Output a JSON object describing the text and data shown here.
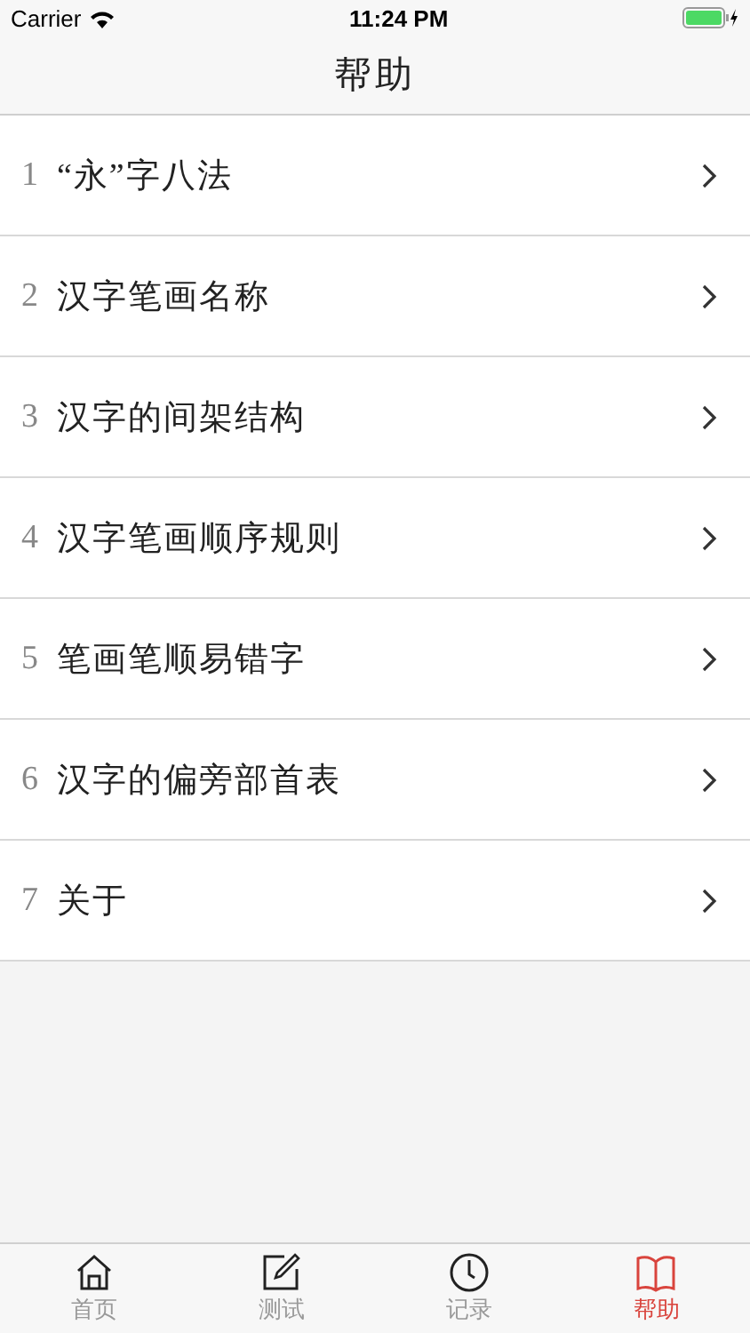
{
  "status_bar": {
    "carrier": "Carrier",
    "time": "11:24 PM"
  },
  "nav": {
    "title": "帮助"
  },
  "items": [
    {
      "number": "1",
      "label": "“永”字八法"
    },
    {
      "number": "2",
      "label": "汉字笔画名称"
    },
    {
      "number": "3",
      "label": "汉字的间架结构"
    },
    {
      "number": "4",
      "label": "汉字笔画顺序规则"
    },
    {
      "number": "5",
      "label": "笔画笔顺易错字"
    },
    {
      "number": "6",
      "label": "汉字的偏旁部首表"
    },
    {
      "number": "7",
      "label": "关于"
    }
  ],
  "tabs": [
    {
      "kind": "home",
      "label": "首页",
      "selected": false
    },
    {
      "kind": "test",
      "label": "测试",
      "selected": false
    },
    {
      "kind": "record",
      "label": "记录",
      "selected": false
    },
    {
      "kind": "help",
      "label": "帮助",
      "selected": true
    }
  ]
}
